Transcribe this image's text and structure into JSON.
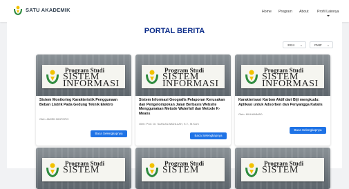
{
  "nav": {
    "brand": "SATU AKADEMIK",
    "items": [
      {
        "label": "Home"
      },
      {
        "label": "Program"
      },
      {
        "label": "About"
      },
      {
        "label": "Profil Lainnya"
      }
    ]
  },
  "page_title": "PORTAL BERITA",
  "filters": {
    "year": "2024",
    "scope": "PMIF"
  },
  "banner": {
    "line1": "Program Studi",
    "line2": "SISTEM",
    "line3": "INFORMASI"
  },
  "cards": [
    {
      "title": "Sistem Monitoring Karakteristik Penggunaan Beban Listrik Pada Gedung Teknik Elektro",
      "author": "Oleh: AMIEN BINTORO",
      "button": "Baca Selengkapnya"
    },
    {
      "title": "Sistem Informasi Geografis Pelaporan Kerusakan dan Pengelompokan Jalan Berbasis Website Menggunakan Metode Waterfall dan Metode K-Means",
      "author": "Oleh: Prof. Dr. SAHLAN ABDILLAH, S.T., M.Kom",
      "button": "Baca Selengkapnya"
    },
    {
      "title": "Karakterisasi Karbon Aktif dari Biji mengkudu: Aplikasi untuk Adsorben dan Penyangga Katalis",
      "author": "Oleh: MUHAMMAD",
      "button": "Baca Selengkapnya"
    }
  ],
  "colors": {
    "accent": "#1f73e6",
    "title": "#0c2d8a",
    "logo_green": "#2e8b3e",
    "logo_yellow": "#f2c200"
  }
}
